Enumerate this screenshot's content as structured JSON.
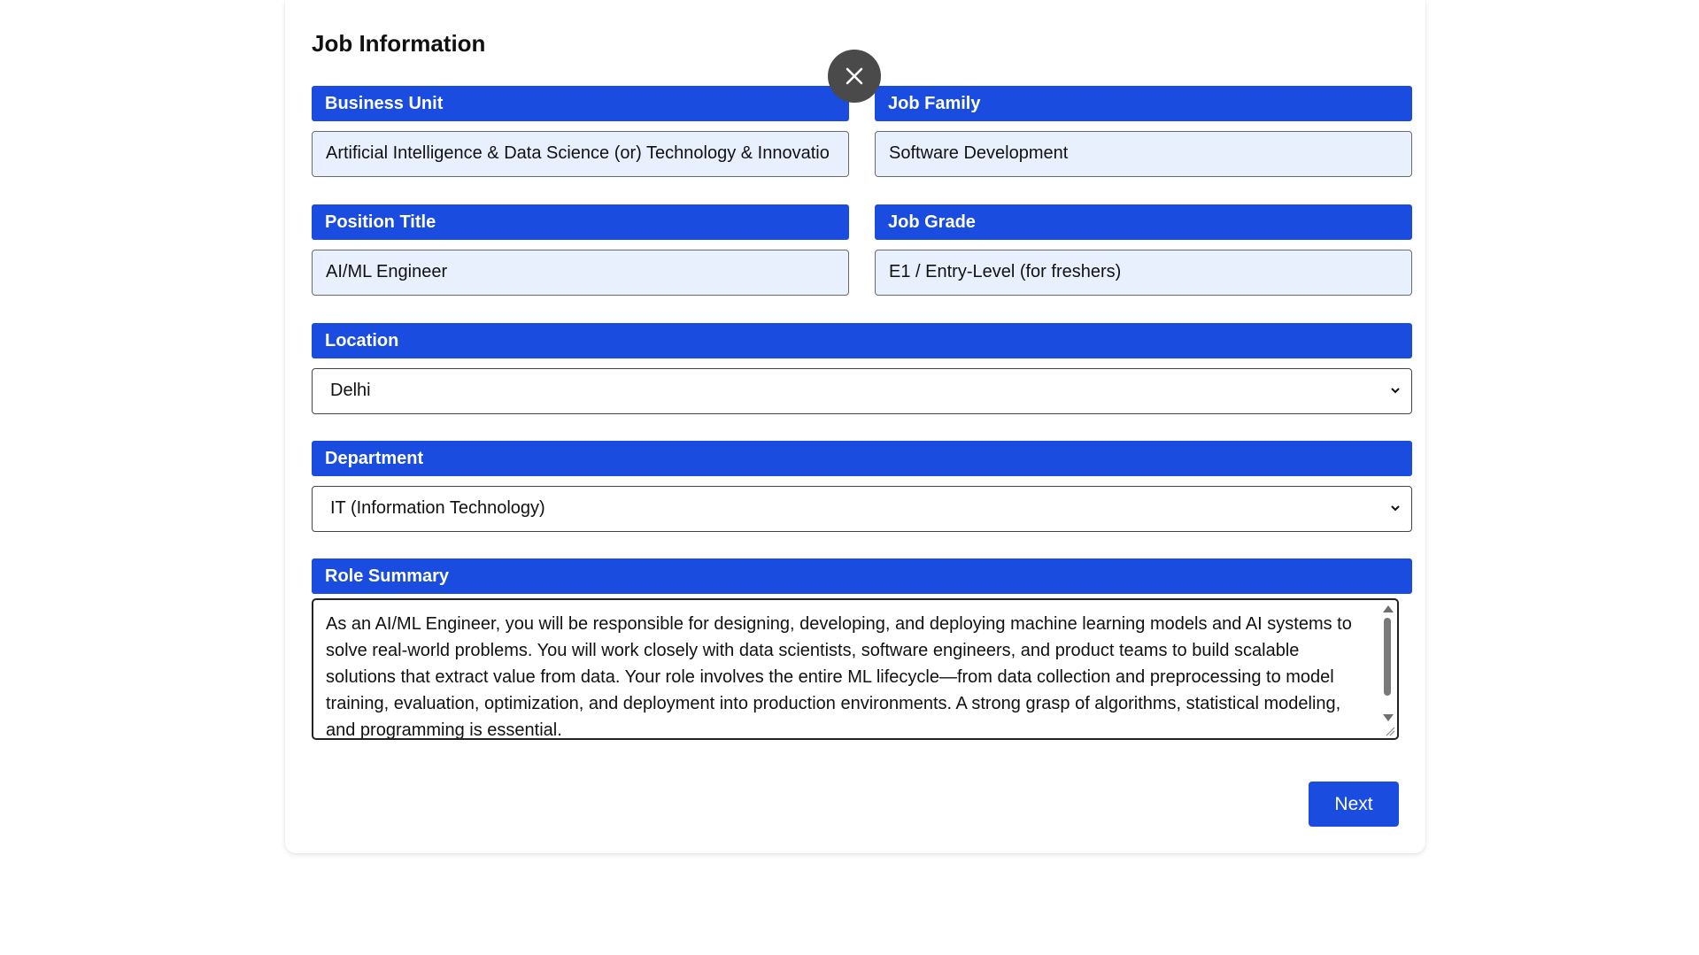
{
  "form": {
    "title": "Job Information",
    "business_unit": {
      "label": "Business Unit",
      "value": "Artificial Intelligence & Data Science (or) Technology & Innovatio"
    },
    "job_family": {
      "label": "Job Family",
      "value": "Software Development"
    },
    "position_title": {
      "label": "Position Title",
      "value": "AI/ML Engineer"
    },
    "job_grade": {
      "label": "Job Grade",
      "value": "E1 / Entry-Level (for freshers)"
    },
    "location": {
      "label": "Location",
      "selected": "Delhi"
    },
    "department": {
      "label": "Department",
      "selected": "IT (Information Technology)"
    },
    "role_summary": {
      "label": "Role Summary",
      "value": "As an AI/ML Engineer, you will be responsible for designing, developing, and deploying machine learning models and AI systems to solve real-world problems. You will work closely with data scientists, software engineers, and product teams to build scalable solutions that extract value from data. Your role involves the entire ML lifecycle—from data collection and preprocessing to model training, evaluation, optimization, and deployment into production environments. A strong grasp of algorithms, statistical modeling, and programming is essential."
    },
    "next_label": "Next"
  },
  "icons": {
    "close": "close-icon",
    "dropdown": "chevron-down-icon"
  },
  "colors": {
    "accent": "#1a4ce0",
    "readonly_bg": "#e8f0fe",
    "close_bg": "#4a4a4a"
  }
}
